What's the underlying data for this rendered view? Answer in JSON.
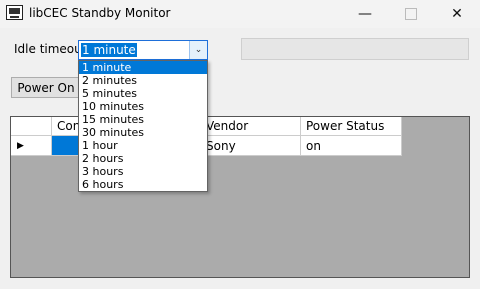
{
  "window": {
    "title": "libCEC Standby Monitor"
  },
  "idle": {
    "label": "Idle timeout",
    "selected": "1 minute",
    "options": [
      "1 minute",
      "2 minutes",
      "5 minutes",
      "10 minutes",
      "15 minutes",
      "30 minutes",
      "1 hour",
      "2 hours",
      "3 hours",
      "6 hours"
    ]
  },
  "status_text": "",
  "power_button": "Power On",
  "grid": {
    "columns": [
      "",
      "Connection",
      "Vendor",
      "Power Status"
    ],
    "columns_visible": [
      "",
      "Con",
      "Vendor",
      "Power Status"
    ],
    "rows": [
      {
        "connection": "",
        "vendor": "Sony",
        "power_status": "on"
      }
    ]
  }
}
